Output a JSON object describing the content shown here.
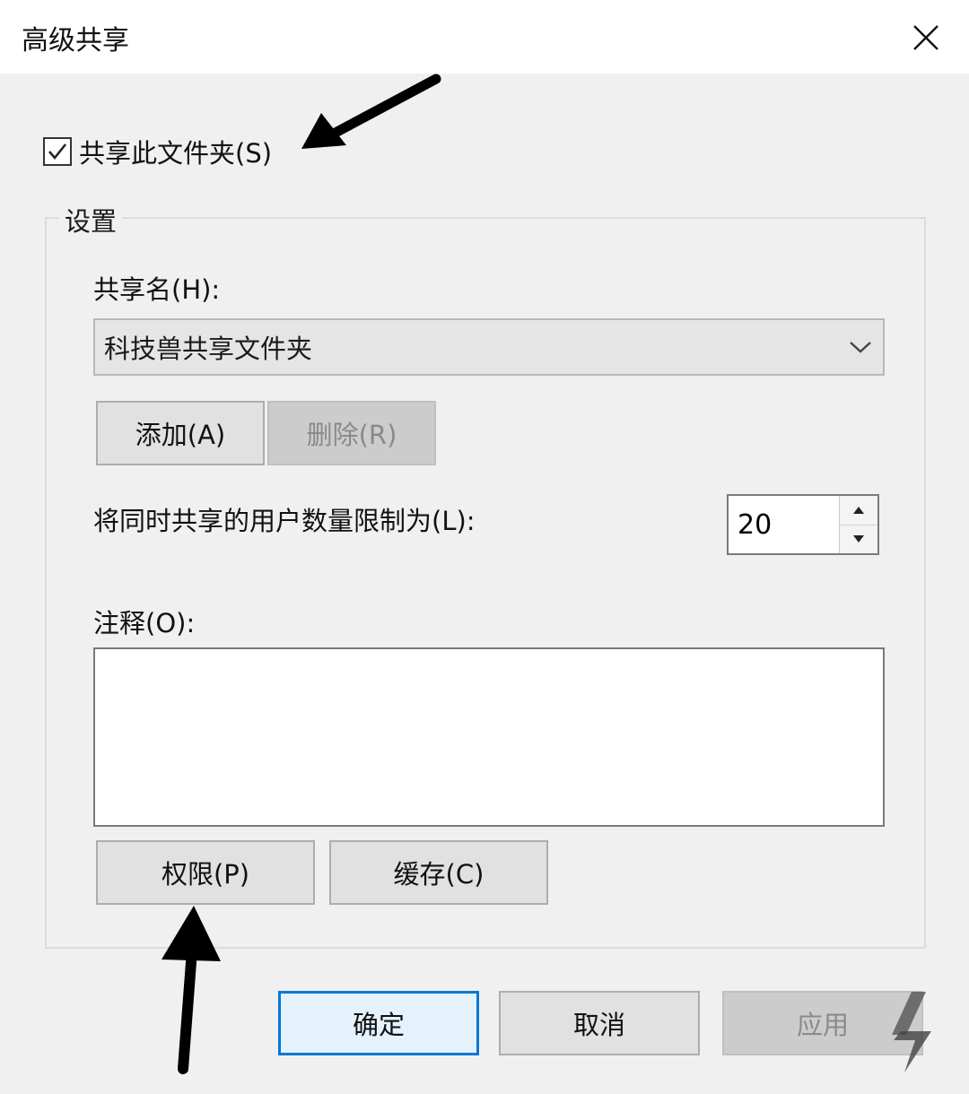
{
  "window": {
    "title": "高级共享"
  },
  "share": {
    "checkbox_label": "共享此文件夹(S)",
    "checked": true
  },
  "settings": {
    "group_label": "设置",
    "share_name_label": "共享名(H):",
    "share_name_value": "科技兽共享文件夹",
    "add_button": "添加(A)",
    "remove_button": "删除(R)",
    "user_limit_label": "将同时共享的用户数量限制为(L):",
    "user_limit_value": "20",
    "comment_label": "注释(O):",
    "comment_value": "",
    "permissions_button": "权限(P)",
    "cache_button": "缓存(C)"
  },
  "footer": {
    "ok_button": "确定",
    "cancel_button": "取消",
    "apply_button": "应用"
  },
  "colors": {
    "accent": "#0078d7",
    "disabled_text": "#8a8a8a"
  }
}
